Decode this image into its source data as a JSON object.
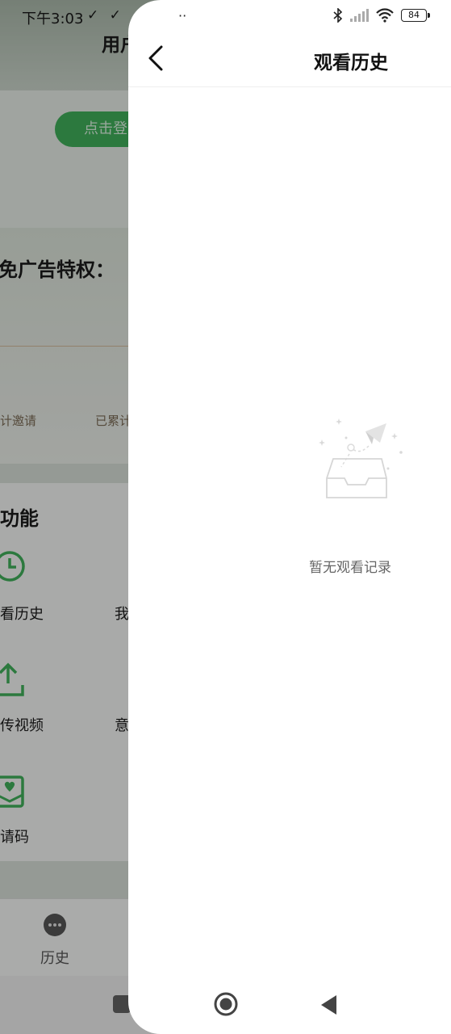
{
  "status_bar": {
    "time": "下午3:03",
    "left_icons": "✓ ✓ ✓",
    "dots": "··",
    "battery": "84"
  },
  "background_page": {
    "title": "用户",
    "login_button": "点击登",
    "privilege_heading": "免广告特权：",
    "invite_label": "计邀请",
    "invited_label": "已累计",
    "features_heading": "功能",
    "feature_history": "看历史",
    "feature_mine": "我",
    "feature_upload": "传视频",
    "feature_feedback": "意",
    "feature_invite_code": "请码",
    "nav_history": "历史"
  },
  "drawer": {
    "header": {
      "title": "观看历史"
    },
    "empty_state": {
      "message": "暂无观看记录"
    }
  },
  "colors": {
    "accent": "#3fae5a",
    "text_primary": "#111111",
    "text_secondary": "#666666"
  }
}
